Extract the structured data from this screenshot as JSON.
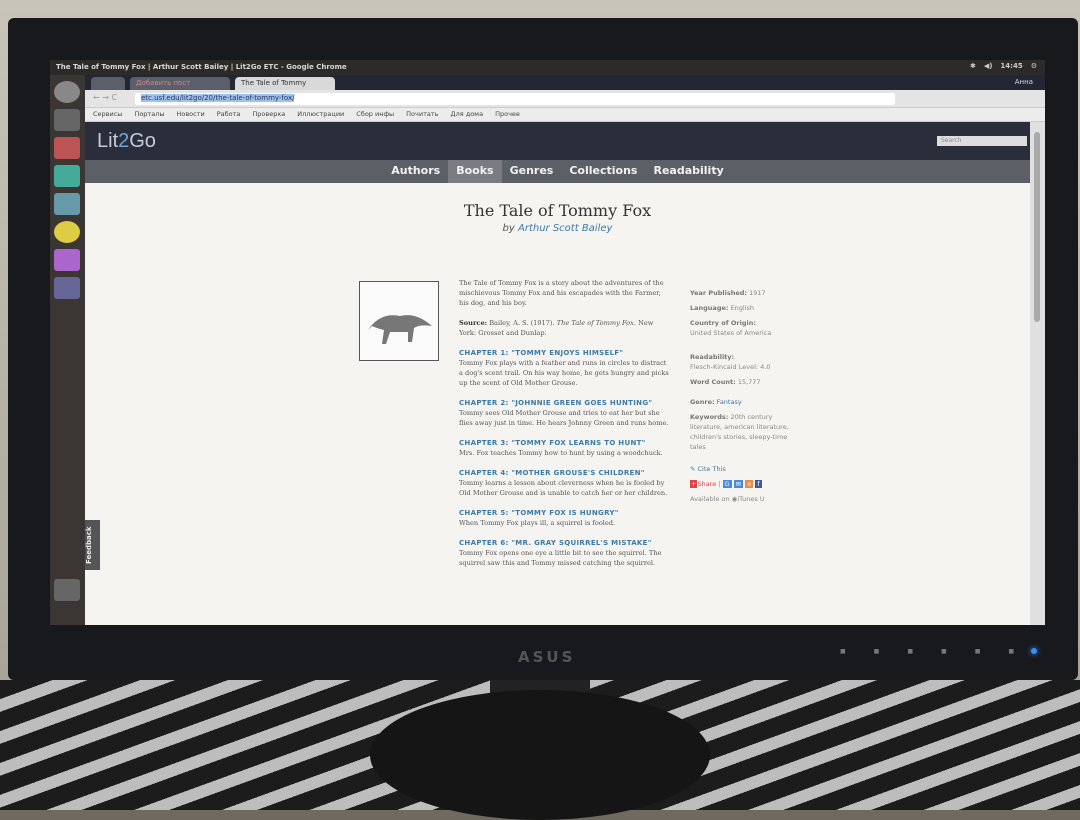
{
  "window": {
    "title": "The Tale of Tommy Fox | Arthur Scott Bailey | Lit2Go ETC - Google Chrome",
    "clock": "14:45",
    "user": "Анна"
  },
  "tabs": [
    {
      "label": "Добавить пост"
    },
    {
      "label": "The Tale of Tommy"
    }
  ],
  "address": {
    "url": "etc.usf.edu/lit2go/20/the-tale-of-tommy-fox/"
  },
  "bookmarks": [
    "Сервисы",
    "Порталы",
    "Новости",
    "Работа",
    "Проверка",
    "Иллюстрации",
    "Сбор инфы",
    "Почитать",
    "Для дома",
    "Прочее"
  ],
  "site": {
    "logo_pre": "Lit",
    "logo_mid": "2",
    "logo_post": "Go",
    "search_placeholder": "Search",
    "nav": [
      "Authors",
      "Books",
      "Genres",
      "Collections",
      "Readability"
    ],
    "active_nav": "Books",
    "feedback": "Feedback"
  },
  "book": {
    "title": "The Tale of Tommy Fox",
    "by": "by",
    "author": "Arthur Scott Bailey",
    "description": "The Tale of Tommy Fox is a story about the adventures of the mischievous Tommy Fox and his escapades with the Farmer, his dog, and his boy.",
    "source_label": "Source:",
    "source_text": "Bailey, A. S. (1917).",
    "source_title": "The Tale of Tommy Fox.",
    "source_pub": "New York: Grosset and Dunlap.",
    "chapters": [
      {
        "title": "CHAPTER 1: \"TOMMY ENJOYS HIMSELF\"",
        "summary": "Tommy Fox plays with a feather and runs in circles to distract a dog's scent trail. On his way home, he gets hungry and picks up the scent of Old Mother Grouse."
      },
      {
        "title": "CHAPTER 2: \"JOHNNIE GREEN GOES HUNTING\"",
        "summary": "Tommy sees Old Mother Grouse and tries to eat her but she flies away just in time. He hears Johnny Green and runs home."
      },
      {
        "title": "CHAPTER 3: \"TOMMY FOX LEARNS TO HUNT\"",
        "summary": "Mrs. Fox teaches Tommy how to hunt by using a woodchuck."
      },
      {
        "title": "CHAPTER 4: \"MOTHER GROUSE'S CHILDREN\"",
        "summary": "Tommy learns a lesson about cleverness when he is fooled by Old Mother Grouse and is unable to catch her or her children."
      },
      {
        "title": "CHAPTER 5: \"TOMMY FOX IS HUNGRY\"",
        "summary": "When Tommy Fox plays ill, a squirrel is fooled."
      },
      {
        "title": "CHAPTER 6: \"MR. GRAY SQUIRREL'S MISTAKE\"",
        "summary": "Tommy Fox opens one eye a little bit to see the squirrel. The squirrel saw this and Tommy missed catching the squirrel."
      }
    ]
  },
  "meta": {
    "year_label": "Year Published:",
    "year": "1917",
    "lang_label": "Language:",
    "lang": "English",
    "country_label": "Country of Origin:",
    "country": "United States of America",
    "read_label": "Readability:",
    "read": "Flesch-Kincaid Level: 4.0",
    "wc_label": "Word Count:",
    "wc": "15,777",
    "genre_label": "Genre:",
    "genre": "Fantasy",
    "kw_label": "Keywords:",
    "kw": "20th century literature, american literature, children's stories, sleepy-time tales",
    "cite": "✎ Cite This",
    "share": "Share",
    "available": "Available on",
    "itunes": "iTunes U"
  },
  "monitor": {
    "brand": "ASUS"
  }
}
